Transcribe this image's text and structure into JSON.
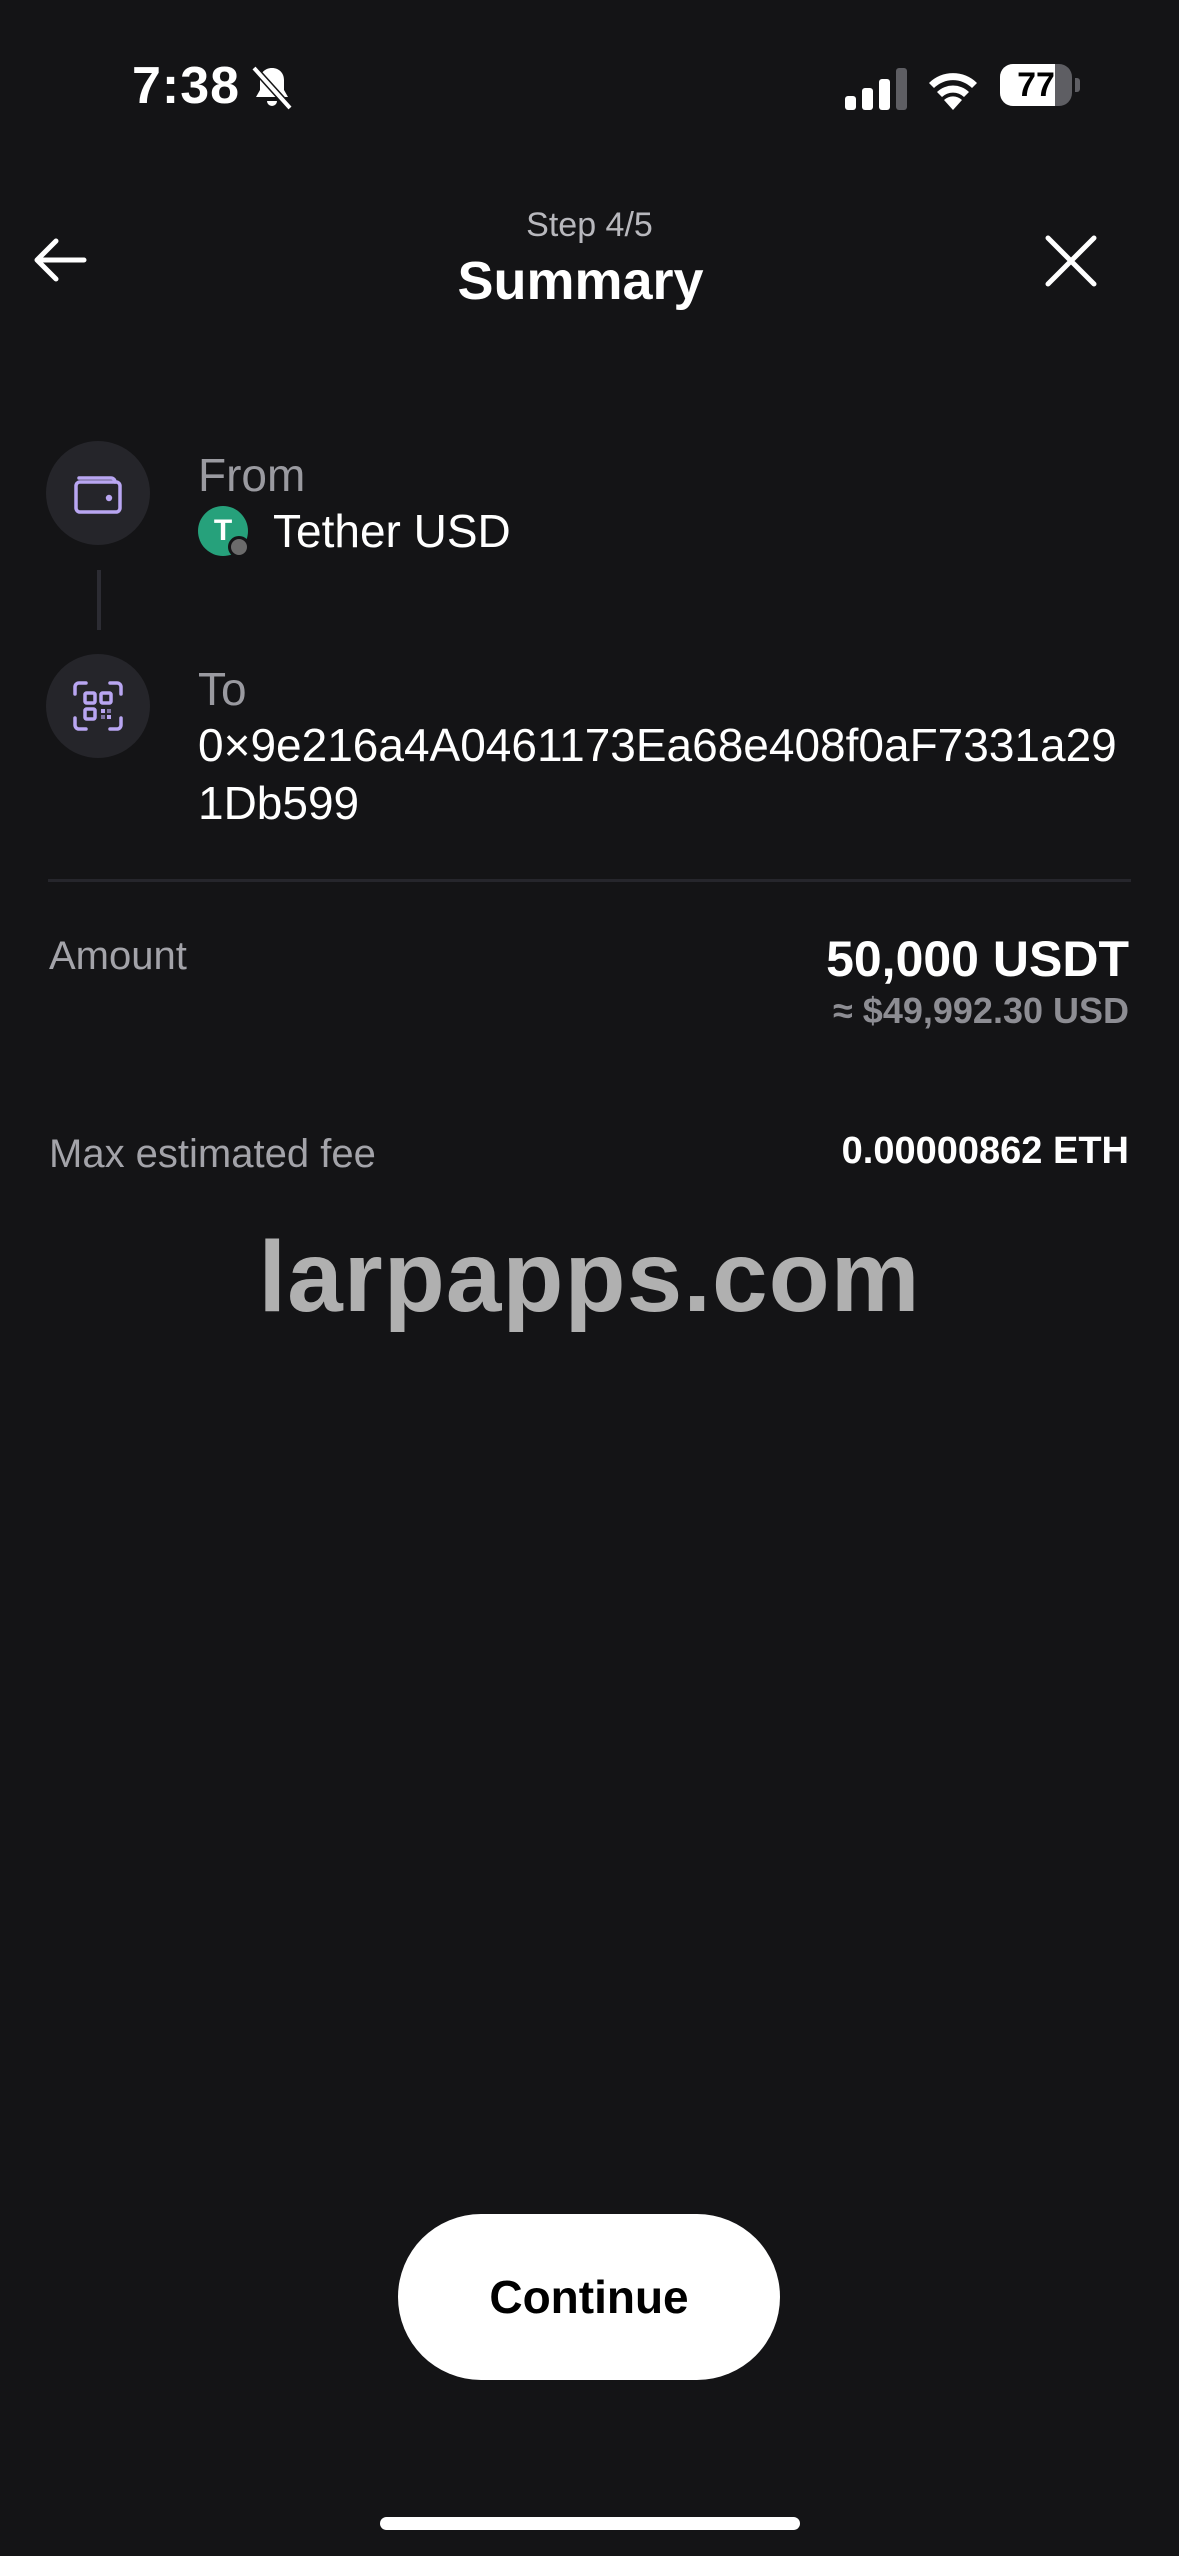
{
  "status_bar": {
    "time": "7:38",
    "battery_percent": "77",
    "battery_level": 0.77,
    "icons": [
      "bell-slash-icon",
      "signal-icon",
      "wifi-icon",
      "battery-icon"
    ]
  },
  "header": {
    "step": "Step 4/5",
    "title": "Summary",
    "back_icon": "arrow-left-icon",
    "close_icon": "close-icon"
  },
  "from": {
    "label": "From",
    "token_name": "Tether USD",
    "token_symbol_glyph": "T",
    "icon": "wallet-icon",
    "token_color": "#26a17b"
  },
  "to": {
    "label": "To",
    "address": "0×9e216a4A0461173Ea68e408f0aF7331a291Db599",
    "icon": "qr-scan-icon"
  },
  "amount": {
    "label": "Amount",
    "value": "50,000 USDT",
    "fiat": "≈ $49,992.30 USD"
  },
  "fee": {
    "label": "Max estimated fee",
    "value": "0.00000862 ETH"
  },
  "watermark": "larpapps.com",
  "continue_label": "Continue",
  "colors": {
    "background": "#141416",
    "accent": "#b9a6f2"
  }
}
